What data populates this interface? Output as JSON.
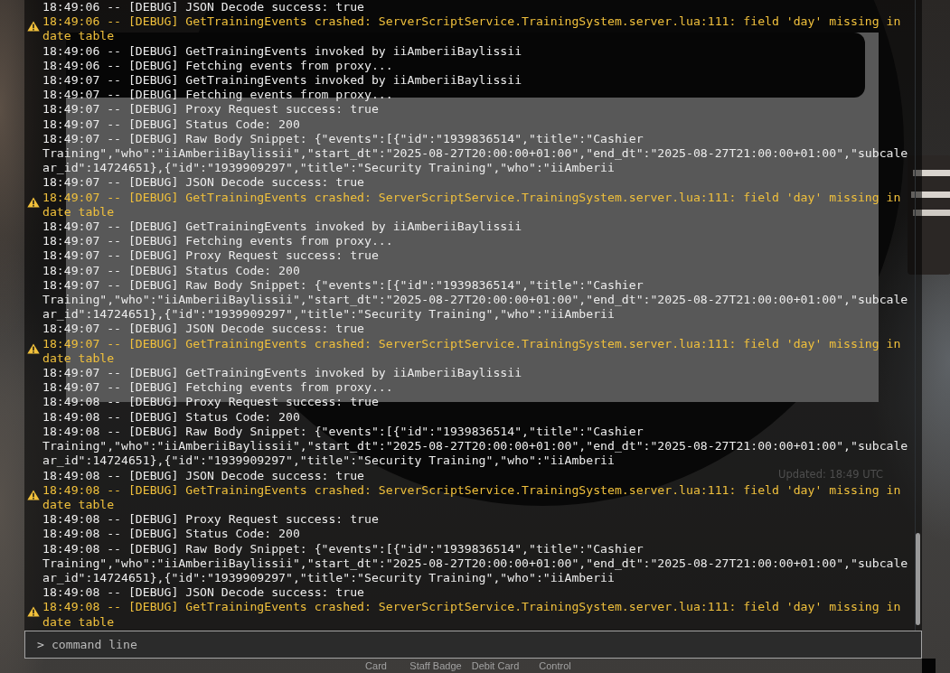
{
  "console": {
    "entries": [
      {
        "kind": "debug",
        "lines": [
          "18:49:06 -- [DEBUG] JSON Decode success: true"
        ]
      },
      {
        "kind": "warning",
        "lines": [
          "18:49:06 -- [DEBUG] GetTrainingEvents crashed: ServerScriptService.TrainingSystem.server.lua:111: field 'day' missing in",
          "date table"
        ]
      },
      {
        "kind": "debug",
        "lines": [
          "18:49:06 -- [DEBUG] GetTrainingEvents invoked by iiAmberiiBaylissii"
        ]
      },
      {
        "kind": "debug",
        "lines": [
          "18:49:06 -- [DEBUG] Fetching events from proxy..."
        ]
      },
      {
        "kind": "debug",
        "lines": [
          "18:49:07 -- [DEBUG] GetTrainingEvents invoked by iiAmberiiBaylissii"
        ]
      },
      {
        "kind": "debug",
        "lines": [
          "18:49:07 -- [DEBUG] Fetching events from proxy..."
        ]
      },
      {
        "kind": "debug",
        "lines": [
          "18:49:07 -- [DEBUG] Proxy Request success: true"
        ]
      },
      {
        "kind": "debug",
        "lines": [
          "18:49:07 -- [DEBUG] Status Code: 200"
        ]
      },
      {
        "kind": "debug",
        "lines": [
          "18:49:07 -- [DEBUG] Raw Body Snippet: {\"events\":[{\"id\":\"1939836514\",\"title\":\"Cashier",
          "Training\",\"who\":\"iiAmberiiBaylissii\",\"start_dt\":\"2025-08-27T20:00:00+01:00\",\"end_dt\":\"2025-08-27T21:00:00+01:00\",\"subcale",
          "ar_id\":14724651},{\"id\":\"1939909297\",\"title\":\"Security Training\",\"who\":\"iiAmberii"
        ]
      },
      {
        "kind": "debug",
        "lines": [
          "18:49:07 -- [DEBUG] JSON Decode success: true"
        ]
      },
      {
        "kind": "warning",
        "lines": [
          "18:49:07 -- [DEBUG] GetTrainingEvents crashed: ServerScriptService.TrainingSystem.server.lua:111: field 'day' missing in",
          "date table"
        ]
      },
      {
        "kind": "debug",
        "lines": [
          "18:49:07 -- [DEBUG] GetTrainingEvents invoked by iiAmberiiBaylissii"
        ]
      },
      {
        "kind": "debug",
        "lines": [
          "18:49:07 -- [DEBUG] Fetching events from proxy..."
        ]
      },
      {
        "kind": "debug",
        "lines": [
          "18:49:07 -- [DEBUG] Proxy Request success: true"
        ]
      },
      {
        "kind": "debug",
        "lines": [
          "18:49:07 -- [DEBUG] Status Code: 200"
        ]
      },
      {
        "kind": "debug",
        "lines": [
          "18:49:07 -- [DEBUG] Raw Body Snippet: {\"events\":[{\"id\":\"1939836514\",\"title\":\"Cashier",
          "Training\",\"who\":\"iiAmberiiBaylissii\",\"start_dt\":\"2025-08-27T20:00:00+01:00\",\"end_dt\":\"2025-08-27T21:00:00+01:00\",\"subcale",
          "ar_id\":14724651},{\"id\":\"1939909297\",\"title\":\"Security Training\",\"who\":\"iiAmberii"
        ]
      },
      {
        "kind": "debug",
        "lines": [
          "18:49:07 -- [DEBUG] JSON Decode success: true"
        ]
      },
      {
        "kind": "warning",
        "lines": [
          "18:49:07 -- [DEBUG] GetTrainingEvents crashed: ServerScriptService.TrainingSystem.server.lua:111: field 'day' missing in",
          "date table"
        ]
      },
      {
        "kind": "debug",
        "lines": [
          "18:49:07 -- [DEBUG] GetTrainingEvents invoked by iiAmberiiBaylissii"
        ]
      },
      {
        "kind": "debug",
        "lines": [
          "18:49:07 -- [DEBUG] Fetching events from proxy..."
        ]
      },
      {
        "kind": "debug",
        "lines": [
          "18:49:08 -- [DEBUG] Proxy Request success: true"
        ]
      },
      {
        "kind": "debug",
        "lines": [
          "18:49:08 -- [DEBUG] Status Code: 200"
        ]
      },
      {
        "kind": "debug",
        "lines": [
          "18:49:08 -- [DEBUG] Raw Body Snippet: {\"events\":[{\"id\":\"1939836514\",\"title\":\"Cashier",
          "Training\",\"who\":\"iiAmberiiBaylissii\",\"start_dt\":\"2025-08-27T20:00:00+01:00\",\"end_dt\":\"2025-08-27T21:00:00+01:00\",\"subcale",
          "ar_id\":14724651},{\"id\":\"1939909297\",\"title\":\"Security Training\",\"who\":\"iiAmberii"
        ]
      },
      {
        "kind": "debug",
        "lines": [
          "18:49:08 -- [DEBUG] JSON Decode success: true"
        ]
      },
      {
        "kind": "warning",
        "lines": [
          "18:49:08 -- [DEBUG] GetTrainingEvents crashed: ServerScriptService.TrainingSystem.server.lua:111: field 'day' missing in",
          "date table"
        ]
      },
      {
        "kind": "debug",
        "lines": [
          "18:49:08 -- [DEBUG] Proxy Request success: true"
        ]
      },
      {
        "kind": "debug",
        "lines": [
          "18:49:08 -- [DEBUG] Status Code: 200"
        ]
      },
      {
        "kind": "debug",
        "lines": [
          "18:49:08 -- [DEBUG] Raw Body Snippet: {\"events\":[{\"id\":\"1939836514\",\"title\":\"Cashier",
          "Training\",\"who\":\"iiAmberiiBaylissii\",\"start_dt\":\"2025-08-27T20:00:00+01:00\",\"end_dt\":\"2025-08-27T21:00:00+01:00\",\"subcale",
          "ar_id\":14724651},{\"id\":\"1939909297\",\"title\":\"Security Training\",\"who\":\"iiAmberii"
        ]
      },
      {
        "kind": "debug",
        "lines": [
          "18:49:08 -- [DEBUG] JSON Decode success: true"
        ]
      },
      {
        "kind": "warning",
        "lines": [
          "18:49:08 -- [DEBUG] GetTrainingEvents crashed: ServerScriptService.TrainingSystem.server.lua:111: field 'day' missing in",
          "date table"
        ]
      }
    ]
  },
  "command_line": {
    "prompt": ">",
    "placeholder": "command line"
  },
  "scene": {
    "status_text": "Updated: 18:49 UTC",
    "hotbar_labels": [
      "Card",
      "Staff Badge",
      "Debit Card",
      "Control"
    ]
  }
}
